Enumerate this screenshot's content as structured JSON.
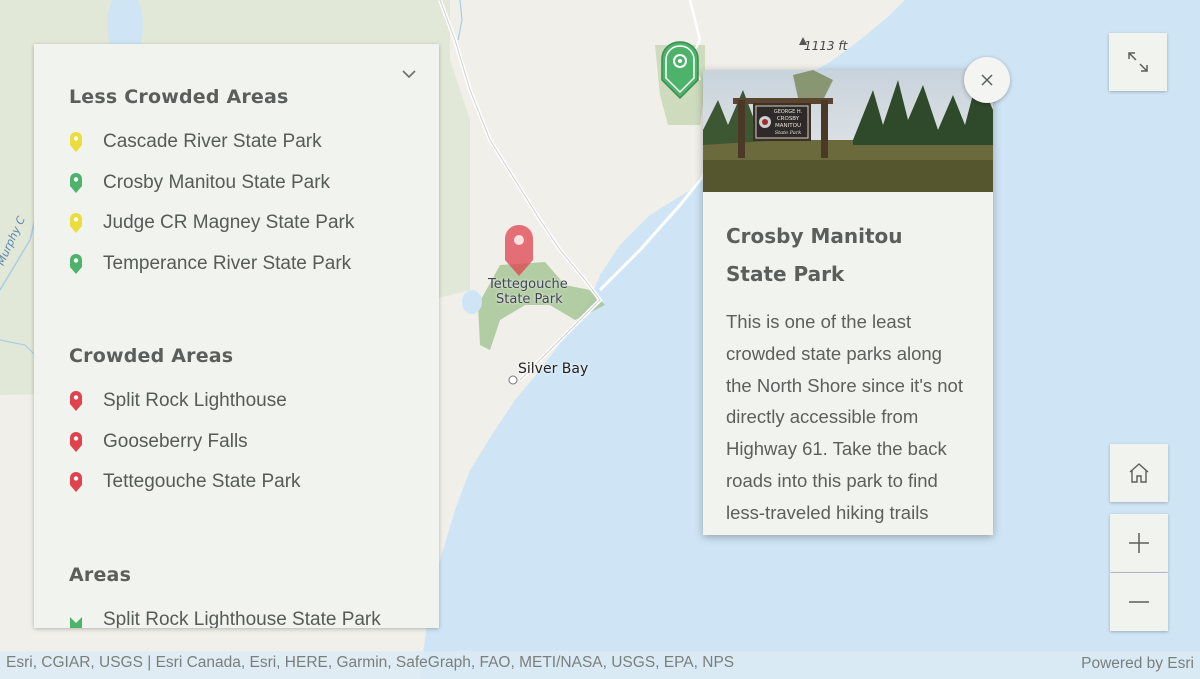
{
  "legend": {
    "sections": [
      {
        "title": "Less Crowded Areas",
        "items": [
          {
            "label": "Cascade River State Park",
            "color": "#ecdc3d"
          },
          {
            "label": "Crosby Manitou State Park",
            "color": "#4db36a"
          },
          {
            "label": "Judge CR Magney State Park",
            "color": "#ecdc3d"
          },
          {
            "label": "Temperance River State Park",
            "color": "#4db36a"
          }
        ]
      },
      {
        "title": "Crowded Areas",
        "items": [
          {
            "label": "Split Rock Lighthouse",
            "color": "#e0434d"
          },
          {
            "label": "Gooseberry Falls",
            "color": "#e0434d"
          },
          {
            "label": "Tettegouche State Park",
            "color": "#e0434d"
          }
        ]
      },
      {
        "title": "Areas",
        "items": [
          {
            "label": "Split Rock Lighthouse State Park",
            "color": "#4db36a"
          }
        ]
      }
    ]
  },
  "popup": {
    "title": "Crosby Manitou State Park",
    "body": "This is one of the least crowded state parks along the North Shore since it's not directly accessible from Highway 61. Take the back roads into this park to find less-traveled hiking trails",
    "sign_text": [
      "GEORGE H.",
      "CROSBY",
      "MANITOU",
      "State Park"
    ]
  },
  "map_labels": {
    "elevation": "1113 ft",
    "park_line1": "Tettegouche",
    "park_line2": "State Park",
    "town": "Silver Bay",
    "river": "Murphy C"
  },
  "attribution": {
    "left": "Esri, CGIAR, USGS | Esri Canada, Esri, HERE, Garmin, SafeGraph, FAO, METI/NASA, USGS, EPA, NPS",
    "right": "Powered by Esri"
  },
  "controls": {
    "expand": "expand-icon",
    "home": "home-icon",
    "zoom_in": "plus-icon",
    "zoom_out": "minus-icon",
    "close": "close-icon",
    "collapse": "chevron-down-icon"
  },
  "colors": {
    "water": "#cfe5f5",
    "land": "#f0efe9",
    "park": "#b9cfa3",
    "accent_green": "#4db36a",
    "accent_red": "#e0434d",
    "accent_yellow": "#ecdc3d"
  }
}
